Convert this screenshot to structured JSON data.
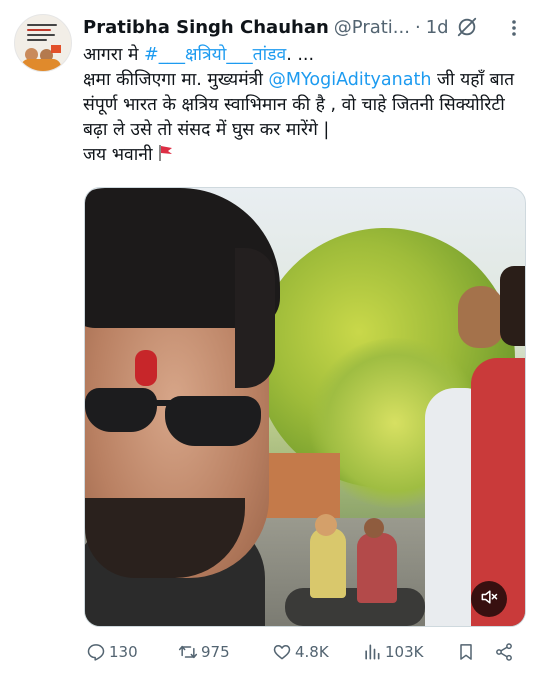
{
  "tweet": {
    "author_name": "Pratibha Singh Chauhan",
    "author_handle": "@Prati...",
    "separator": "·",
    "time": "1d",
    "text": {
      "line1_prefix": "आगरा मे ",
      "line1_hashtag": "#___क्षत्रियो___तांडव",
      "line1_suffix": ". ...",
      "line2_prefix": "क्षमा कीजिएगा मा. मुख्यमंत्री ",
      "line2_mention": "@MYogiAdityanath",
      "line2_suffix": " जी यहाँ बात संपूर्ण भारत के क्षत्रिय स्वाभिमान की है , वो चाहे जितनी सिक्योरिटी बढ़ा ले उसे तो संसद में घुस कर मारेंगे |",
      "line3": "जय भवानी",
      "line3_emoji": "🚩"
    }
  },
  "actions": {
    "replies": "130",
    "reposts": "975",
    "likes": "4.8K",
    "views": "103K"
  },
  "icons": {
    "grok": "grok-icon",
    "more": "more-icon",
    "mute": "mute-icon",
    "reply": "reply-icon",
    "repost": "repost-icon",
    "like": "like-icon",
    "views": "views-icon",
    "bookmark": "bookmark-icon",
    "share": "share-icon"
  },
  "colors": {
    "link": "#1d9bf0",
    "text": "#0f1419",
    "muted": "#536471"
  }
}
